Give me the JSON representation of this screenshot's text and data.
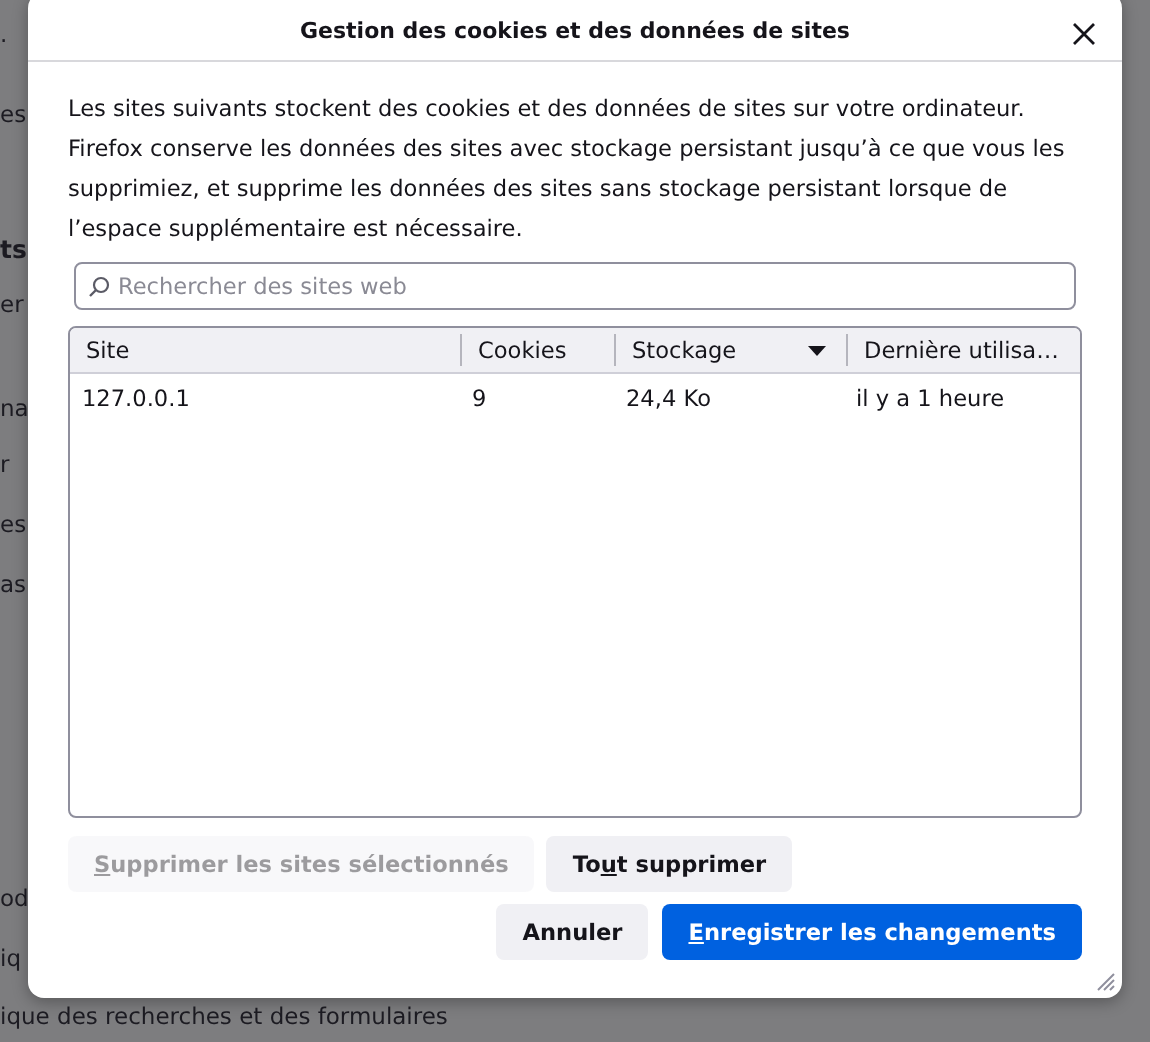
{
  "background_page": {
    "fragments": [
      {
        "text": ".",
        "kind": "plain"
      },
      {
        "text": "es",
        "kind": "plain"
      },
      {
        "text": "ts",
        "kind": "heading"
      },
      {
        "text": "er",
        "kind": "plain"
      },
      {
        "text": "na",
        "kind": "plain"
      },
      {
        "text": "r",
        "kind": "plain"
      },
      {
        "text": "es",
        "kind": "plain"
      },
      {
        "text": "as",
        "kind": "plain"
      },
      {
        "text": "od",
        "kind": "plain"
      },
      {
        "text": "iq",
        "kind": "plain"
      },
      {
        "text": "ique des recherches et des formulaires",
        "kind": "plain"
      }
    ]
  },
  "dialog": {
    "title": "Gestion des cookies et des données de sites",
    "description": "Les sites suivants stockent des cookies et des données de sites sur votre ordinateur. Firefox conserve les données des sites avec stockage persistant jusqu’à ce que vous les supprimiez, et supprime les données des sites sans stockage persistant lorsque de l’espace supplémentaire est nécessaire.",
    "search": {
      "placeholder": "Rechercher des sites web"
    },
    "table": {
      "columns": [
        {
          "label": "Site",
          "sorted": false
        },
        {
          "label": "Cookies",
          "sorted": false
        },
        {
          "label": "Stockage",
          "sorted": true
        },
        {
          "label": "Dernière utilisa…",
          "sorted": false
        }
      ],
      "rows": [
        {
          "cells": [
            "127.0.0.1",
            "9",
            "24,4 Ko",
            "il y a 1 heure"
          ],
          "selected": false
        }
      ]
    },
    "action_buttons": [
      {
        "accesskey": "S",
        "after": "upprimer les sites sélectionnés",
        "disabled": true
      },
      {
        "before": "To",
        "accesskey": "u",
        "after": "t supprimer",
        "disabled": false
      }
    ],
    "footer_buttons": [
      {
        "before": "Annuler",
        "disabled": false,
        "kind": "secondary"
      },
      {
        "accesskey": "E",
        "after": "nregistrer les changements",
        "disabled": false,
        "kind": "primary"
      }
    ]
  }
}
